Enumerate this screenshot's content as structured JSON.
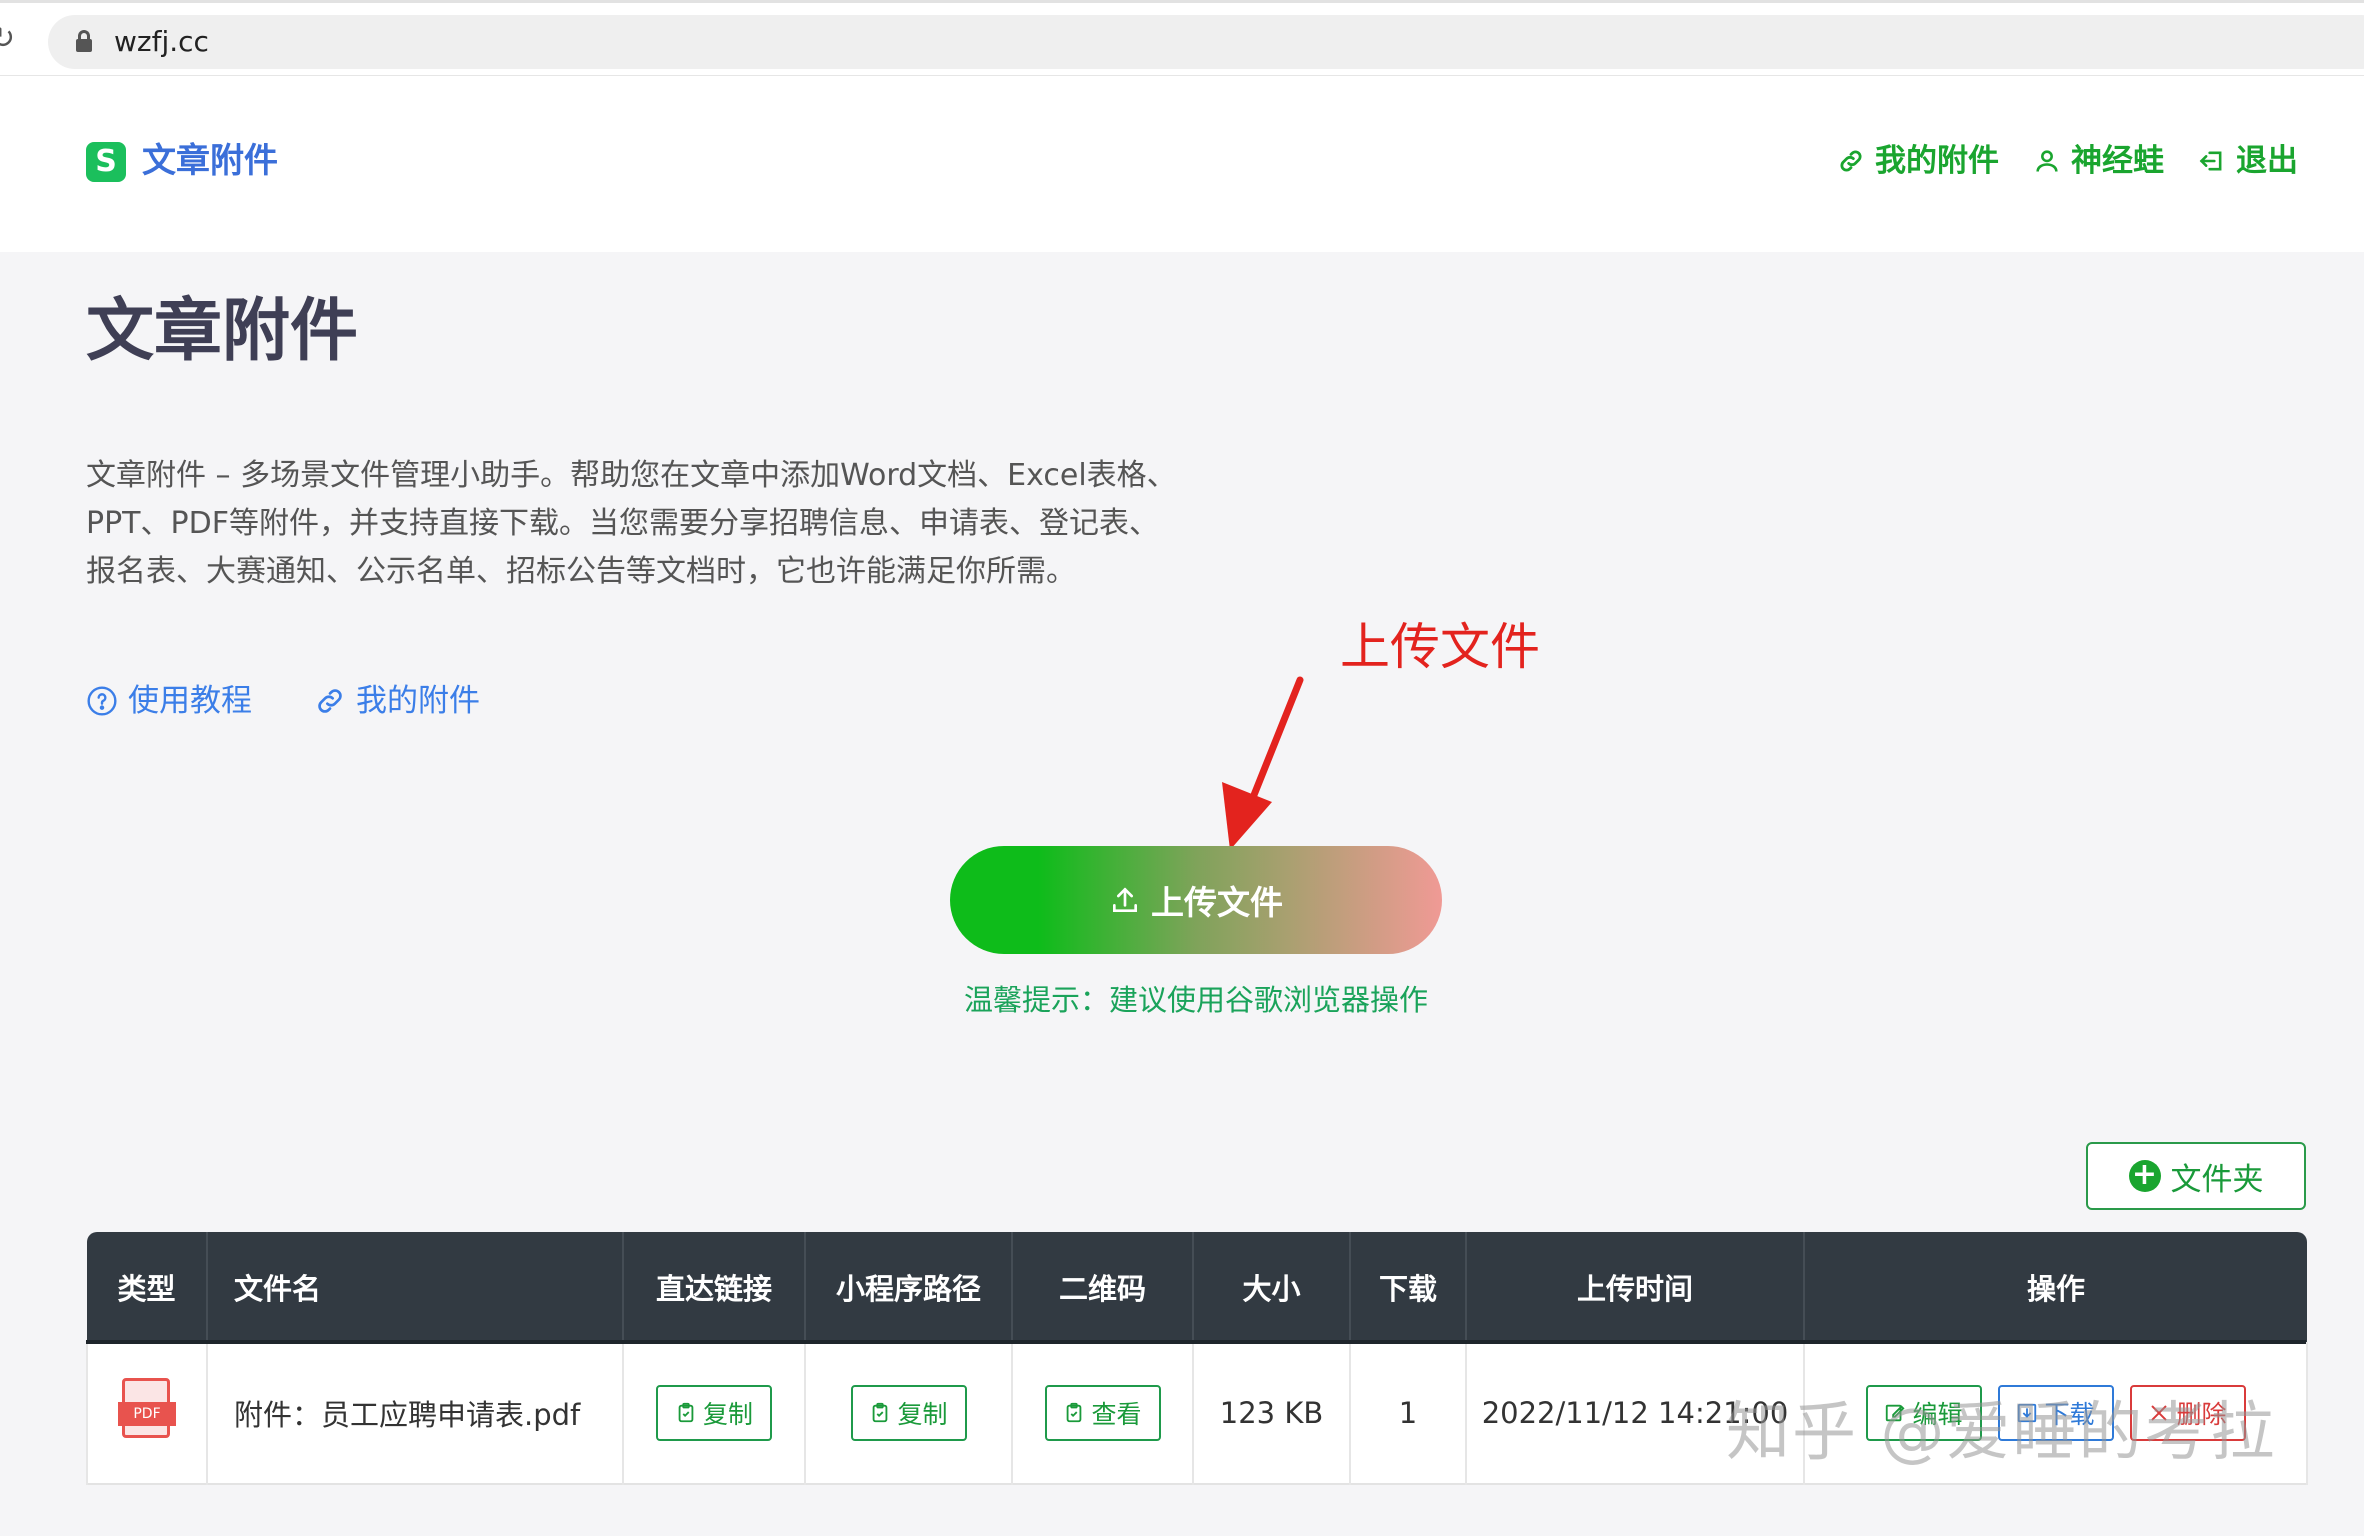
{
  "browser": {
    "url": "wzfj.cc"
  },
  "header": {
    "logo_text": "文章附件",
    "nav": [
      {
        "label": "我的附件",
        "icon": "link-icon"
      },
      {
        "label": "神经蛙",
        "icon": "user-icon"
      },
      {
        "label": "退出",
        "icon": "logout-icon"
      }
    ]
  },
  "hero": {
    "title": "文章附件",
    "description": "文章附件 – 多场景文件管理小助手。帮助您在文章中添加Word文档、Excel表格、PPT、PDF等附件，并支持直接下载。当您需要分享招聘信息、申请表、登记表、报名表、大赛通知、公示名单、招标公告等文档时，它也许能满足你所需。",
    "links": [
      {
        "label": "使用教程",
        "icon": "help-circle-icon"
      },
      {
        "label": "我的附件",
        "icon": "link-icon"
      }
    ],
    "annotation": "上传文件",
    "upload_label": "上传文件",
    "tip": "温馨提示：建议使用谷歌浏览器操作"
  },
  "folder_button": "文件夹",
  "table": {
    "headers": [
      "类型",
      "文件名",
      "直达链接",
      "小程序路径",
      "二维码",
      "大小",
      "下载",
      "上传时间",
      "操作"
    ],
    "rows": [
      {
        "type": "PDF",
        "filename": "附件：员工应聘申请表.pdf",
        "direct_link": "复制",
        "mini_path": "复制",
        "qrcode": "查看",
        "size": "123 KB",
        "downloads": "1",
        "upload_time": "2022/11/12 14:21:00",
        "actions": [
          "编辑",
          "下载",
          "删除"
        ]
      }
    ]
  },
  "watermark": "知乎 @爱睡的考拉",
  "colors": {
    "brand_green": "#1aa52f",
    "link_blue": "#3b7ee8",
    "header_dark": "#323a42",
    "annotation_red": "#e3231e"
  }
}
